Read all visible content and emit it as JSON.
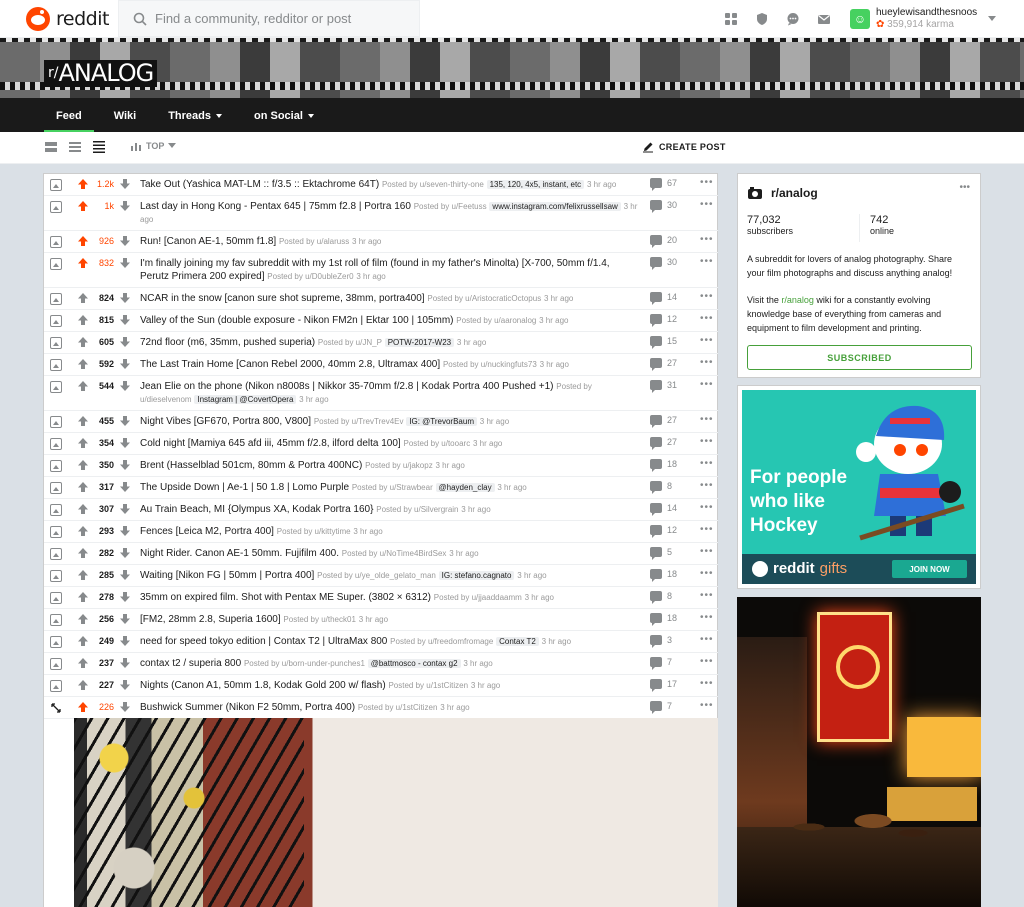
{
  "header": {
    "wordmark": "reddit",
    "search_placeholder": "Find a community, redditor or post",
    "user_name": "hueylewisandthesnoos",
    "user_karma": "359,914 karma"
  },
  "banner": {
    "prefix": "r/",
    "name": "ANALOG",
    "tabs": [
      {
        "label": "Feed",
        "dropdown": false,
        "active": true
      },
      {
        "label": "Wiki",
        "dropdown": false,
        "active": false
      },
      {
        "label": "Threads",
        "dropdown": true,
        "active": false
      },
      {
        "label": "on Social",
        "dropdown": true,
        "active": false
      }
    ]
  },
  "toolbar": {
    "sort_label": "TOP",
    "create_post_label": "CREATE POST"
  },
  "posts": [
    {
      "score": "1.2k",
      "hot": true,
      "title": "Take Out (Yashica MAT-LM :: f/3.5 :: Ektachrome 64T)",
      "meta": "Posted by u/seven-thirty-one",
      "flair": "135, 120, 4x5, instant, etc",
      "time": "3 hr ago",
      "comments": "67"
    },
    {
      "score": "1k",
      "hot": true,
      "title": "Last day in Hong Kong - Pentax 645 | 75mm f2.8 | Portra 160",
      "meta": "Posted by u/Feetuss",
      "flair": "www.instagram.com/felixrussellsaw",
      "time": "3 hr ago",
      "comments": "30"
    },
    {
      "score": "926",
      "hot": true,
      "title": "Run! [Canon AE-1, 50mm f1.8]",
      "meta": "Posted by u/alaruss",
      "flair": "",
      "time": "3 hr ago",
      "comments": "20"
    },
    {
      "score": "832",
      "hot": true,
      "title": "I'm finally joining my fav subreddit with my 1st roll of film (found in my father's Minolta) [X-700, 50mm f/1.4, Perutz Primera 200 expired]",
      "meta": "Posted by u/D0ubleZer0",
      "flair": "",
      "time": "3 hr ago",
      "comments": "30"
    },
    {
      "score": "824",
      "hot": false,
      "title": "NCAR in the snow [canon sure shot supreme, 38mm, portra400]",
      "meta": "Posted by u/AristocraticOctopus",
      "flair": "",
      "time": "3 hr ago",
      "comments": "14"
    },
    {
      "score": "815",
      "hot": false,
      "title": "Valley of the Sun (double exposure - Nikon FM2n | Ektar 100 | 105mm)",
      "meta": "Posted by u/aaronalog",
      "flair": "",
      "time": "3 hr ago",
      "comments": "12"
    },
    {
      "score": "605",
      "hot": false,
      "title": "72nd floor (m6, 35mm, pushed superia)",
      "meta": "Posted by u/JN_P",
      "flair": "POTW-2017-W23",
      "time": "3 hr ago",
      "comments": "15"
    },
    {
      "score": "592",
      "hot": false,
      "title": "The Last Train Home [Canon Rebel 2000, 40mm 2.8, Ultramax 400]",
      "meta": "Posted by u/nuckingfuts73",
      "flair": "",
      "time": "3 hr ago",
      "comments": "27"
    },
    {
      "score": "544",
      "hot": false,
      "title": "Jean Elie on the phone (Nikon n8008s | Nikkor 35-70mm f/2.8 | Kodak Portra 400 Pushed +1)",
      "meta": "Posted by u/dieselvenom",
      "flair": "Instagram | @CovertOpera",
      "time": "3 hr ago",
      "comments": "31"
    },
    {
      "score": "455",
      "hot": false,
      "title": "Night Vibes [GF670, Portra 800, V800]",
      "meta": "Posted by u/TrevTrev4Ev",
      "flair": "IG: @TrevorBaum",
      "time": "3 hr ago",
      "comments": "27"
    },
    {
      "score": "354",
      "hot": false,
      "title": "Cold night [Mamiya 645 afd iii, 45mm f/2.8, ilford delta 100]",
      "meta": "Posted by u/tooarc",
      "flair": "",
      "time": "3 hr ago",
      "comments": "27"
    },
    {
      "score": "350",
      "hot": false,
      "title": "Brent (Hasselblad 501cm, 80mm & Portra 400NC)",
      "meta": "Posted by u/jakopz",
      "flair": "",
      "time": "3 hr ago",
      "comments": "18"
    },
    {
      "score": "317",
      "hot": false,
      "title": "The Upside Down | Ae-1 | 50 1.8 | Lomo Purple",
      "meta": "Posted by u/Strawbear",
      "flair": "@hayden_clay",
      "time": "3 hr ago",
      "comments": "8"
    },
    {
      "score": "307",
      "hot": false,
      "title": "Au Train Beach, MI {Olympus XA, Kodak Portra 160}",
      "meta": "Posted by u/Silvergrain",
      "flair": "",
      "time": "3 hr ago",
      "comments": "14"
    },
    {
      "score": "293",
      "hot": false,
      "title": "Fences [Leica M2, Portra 400]",
      "meta": "Posted by u/kittytime",
      "flair": "",
      "time": "3 hr ago",
      "comments": "12"
    },
    {
      "score": "282",
      "hot": false,
      "title": "Night Rider. Canon AE-1 50mm. Fujifilm 400.",
      "meta": "Posted by u/NoTime4BirdSex",
      "flair": "",
      "time": "3 hr ago",
      "comments": "5"
    },
    {
      "score": "285",
      "hot": false,
      "title": "Waiting [Nikon FG | 50mm | Portra 400]",
      "meta": "Posted by u/ye_olde_gelato_man",
      "flair": "IG: stefano.cagnato",
      "time": "3 hr ago",
      "comments": "18"
    },
    {
      "score": "278",
      "hot": false,
      "title": "35mm on expired film. Shot with Pentax ME Super. (3802 × 6312)",
      "meta": "Posted by u/jjaaddaamm",
      "flair": "",
      "time": "3 hr ago",
      "comments": "8"
    },
    {
      "score": "256",
      "hot": false,
      "title": "[FM2, 28mm 2.8, Superia 1600]",
      "meta": "Posted by u/theck01",
      "flair": "",
      "time": "3 hr ago",
      "comments": "18"
    },
    {
      "score": "249",
      "hot": false,
      "title": "need for speed tokyo edition | Contax T2 | UltraMax 800",
      "meta": "Posted by u/freedomfromage",
      "flair": "Contax T2",
      "time": "3 hr ago",
      "comments": "3"
    },
    {
      "score": "237",
      "hot": false,
      "title": "contax t2 / superia 800",
      "meta": "Posted by u/born-under-punches1",
      "flair": "@battmosco - contax g2",
      "time": "3 hr ago",
      "comments": "7"
    },
    {
      "score": "227",
      "hot": false,
      "title": "Nights (Canon A1, 50mm 1.8, Kodak Gold 200 w/ flash)",
      "meta": "Posted by u/1stCitizen",
      "flair": "",
      "time": "3 hr ago",
      "comments": "17"
    },
    {
      "score": "226",
      "hot": true,
      "title": "Bushwick Summer (Nikon F2 50mm, Portra 400)",
      "meta": "Posted by u/1stCitizen",
      "flair": "",
      "time": "3 hr ago",
      "comments": "7"
    }
  ],
  "sidebar": {
    "name": "r/analog",
    "subscribers": "77,032",
    "subscribers_label": "subscribers",
    "online": "742",
    "online_label": "online",
    "description": "A subreddit for lovers of analog photography. Share your film photographs and discuss anything analog!",
    "desc2_before": "Visit the ",
    "desc2_link": "r/analog",
    "desc2_after": " wiki for a constantly evolving knowledge base of everything from cameras and equipment to film development and printing.",
    "subscribed_label": "SUBSCRIBED"
  },
  "ad": {
    "headline": "For people who like Hockey",
    "logo_word": "reddit",
    "logo_suffix": "gifts",
    "cta": "JOIN NOW"
  },
  "colors": {
    "accent_orange": "#ff4500",
    "accent_green": "#46a03a",
    "ad_teal": "#26c6b2"
  }
}
